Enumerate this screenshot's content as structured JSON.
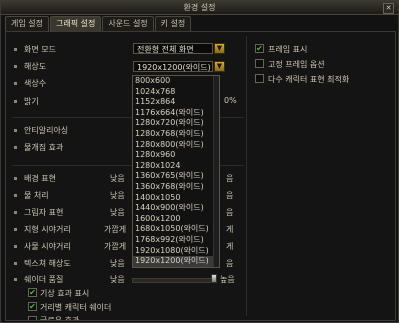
{
  "window": {
    "title": "환경 설정",
    "close_glyph": "✕"
  },
  "tabs": [
    {
      "label": "게임 설정",
      "active": false
    },
    {
      "label": "그래픽 설정",
      "active": true
    },
    {
      "label": "사운드 설정",
      "active": false
    },
    {
      "label": "키 설정",
      "active": false
    }
  ],
  "settings": {
    "screen_mode": {
      "label": "화면 모드",
      "value": "전환형 전체 화면"
    },
    "resolution": {
      "label": "해상도",
      "value": "1920x1200(와이드)"
    },
    "color_depth": {
      "label": "색상수"
    },
    "brightness": {
      "label": "밝기",
      "value_suffix": "0%"
    },
    "antialiasing": {
      "label": "안티알리아싱"
    },
    "fog": {
      "label": "물개짐 효과"
    },
    "background": {
      "label": "배경 표현",
      "left": "낮음",
      "right": "음"
    },
    "water": {
      "label": "물 처리",
      "left": "낮음",
      "right": "음"
    },
    "shadow": {
      "label": "그림자 표현",
      "left": "낮음",
      "right": "음"
    },
    "terrain_distance": {
      "label": "지형 시야거리",
      "left": "가깝게",
      "right": "게"
    },
    "object_distance": {
      "label": "사물 시야거리",
      "left": "가깝게",
      "right": "게"
    },
    "texture": {
      "label": "텍스쳐 해상도",
      "left": "낮음",
      "right": "음"
    },
    "shader": {
      "label": "쉐이더 품질",
      "left": "낮음",
      "right": "높음"
    }
  },
  "resolution_options": [
    "800x600",
    "1024x768",
    "1152x864",
    "1176x664(와이드)",
    "1280x720(와이드)",
    "1280x768(와이드)",
    "1280x800(와이드)",
    "1280x960",
    "1280x1024",
    "1360x765(와이드)",
    "1360x768(와이드)",
    "1400x1050",
    "1440x900(와이드)",
    "1600x1200",
    "1680x1050(와이드)",
    "1768x992(와이드)",
    "1920x1080(와이드)",
    "1920x1200(와이드)"
  ],
  "bottom_checks": [
    {
      "label": "기상 효과 표시",
      "checked": true
    },
    {
      "label": "거리별 캐릭터 쉐이더",
      "checked": true
    },
    {
      "label": "글로우 효과",
      "checked": true
    }
  ],
  "right_checks": [
    {
      "label": "프레임 표시",
      "checked": true
    },
    {
      "label": "고정 프레임 옵션",
      "checked": false
    },
    {
      "label": "다수 캐릭터 표현 최적화",
      "checked": false
    }
  ],
  "check_glyph": "✔",
  "dropdown_glyph": "▼"
}
